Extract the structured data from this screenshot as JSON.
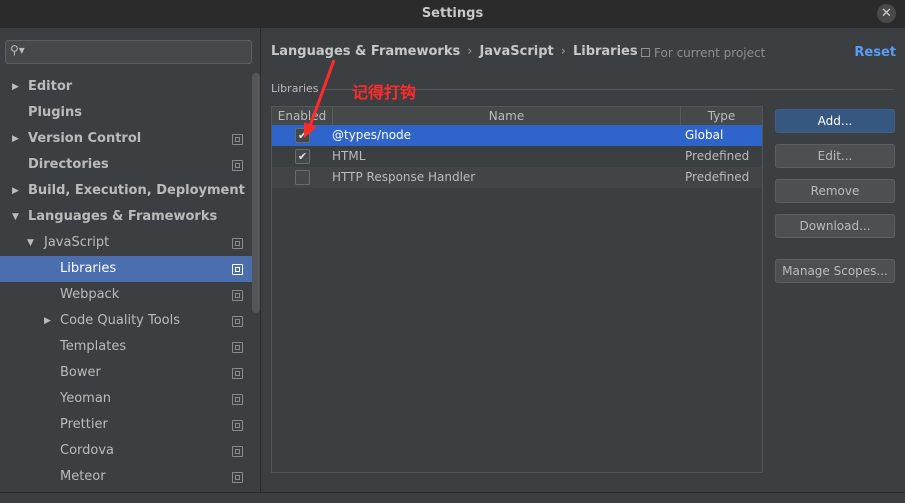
{
  "window": {
    "title": "Settings",
    "close_glyph": "✕"
  },
  "sidebar": {
    "search_placeholder": "",
    "items": [
      {
        "label": "Editor",
        "arrow": "▶",
        "level": 0,
        "bold": true,
        "project": false
      },
      {
        "label": "Plugins",
        "arrow": "",
        "level": 0,
        "bold": true,
        "project": false
      },
      {
        "label": "Version Control",
        "arrow": "▶",
        "level": 0,
        "bold": true,
        "project": true
      },
      {
        "label": "Directories",
        "arrow": "",
        "level": 0,
        "bold": true,
        "project": true
      },
      {
        "label": "Build, Execution, Deployment",
        "arrow": "▶",
        "level": 0,
        "bold": true,
        "project": false
      },
      {
        "label": "Languages & Frameworks",
        "arrow": "▼",
        "level": 0,
        "bold": true,
        "project": false
      },
      {
        "label": "JavaScript",
        "arrow": "▼",
        "level": 1,
        "bold": false,
        "project": true
      },
      {
        "label": "Libraries",
        "arrow": "",
        "level": 2,
        "bold": false,
        "project": true,
        "selected": true
      },
      {
        "label": "Webpack",
        "arrow": "",
        "level": 2,
        "bold": false,
        "project": true
      },
      {
        "label": "Code Quality Tools",
        "arrow": "▶",
        "level": 2,
        "bold": false,
        "project": true
      },
      {
        "label": "Templates",
        "arrow": "",
        "level": 2,
        "bold": false,
        "project": true
      },
      {
        "label": "Bower",
        "arrow": "",
        "level": 2,
        "bold": false,
        "project": true
      },
      {
        "label": "Yeoman",
        "arrow": "",
        "level": 2,
        "bold": false,
        "project": true
      },
      {
        "label": "Prettier",
        "arrow": "",
        "level": 2,
        "bold": false,
        "project": true
      },
      {
        "label": "Cordova",
        "arrow": "",
        "level": 2,
        "bold": false,
        "project": true
      },
      {
        "label": "Meteor",
        "arrow": "",
        "level": 2,
        "bold": false,
        "project": true
      }
    ]
  },
  "header": {
    "breadcrumb": [
      "Languages & Frameworks",
      "JavaScript",
      "Libraries"
    ],
    "separator": "›",
    "for_current_project": "For current project",
    "reset": "Reset"
  },
  "libraries": {
    "section_title": "Libraries",
    "annotation": "记得打钩",
    "columns": [
      "Enabled",
      "Name",
      "Type"
    ],
    "rows": [
      {
        "enabled": true,
        "name": "@types/node",
        "type": "Global",
        "selected": true
      },
      {
        "enabled": true,
        "name": "HTML",
        "type": "Predefined",
        "selected": false
      },
      {
        "enabled": false,
        "name": "HTTP Response Handler",
        "type": "Predefined",
        "selected": false
      }
    ],
    "check_glyph": "✔"
  },
  "buttons": {
    "add": "Add...",
    "edit": "Edit...",
    "remove": "Remove",
    "download": "Download...",
    "manage_scopes": "Manage Scopes..."
  },
  "colors": {
    "accent": "#4b6eaf",
    "selection": "#2f65ca",
    "link": "#589df6",
    "annotation": "#ff2a2a"
  }
}
